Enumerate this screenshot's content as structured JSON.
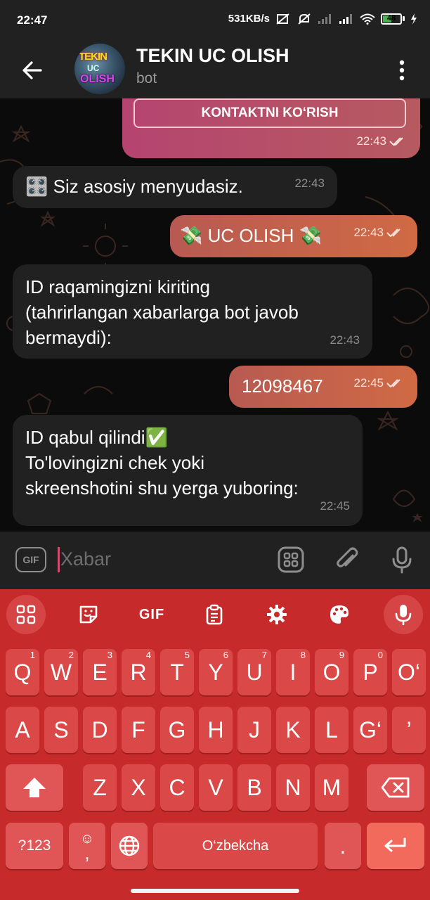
{
  "status_bar": {
    "time": "22:47",
    "network_speed": "531KB/s",
    "battery": "48",
    "battery_level": 0.48,
    "icons": [
      "screenshot-off-icon",
      "mute-icon",
      "signal-icon",
      "signal-icon",
      "wifi-icon",
      "battery-icon",
      "charging-icon"
    ]
  },
  "header": {
    "title": "TEKIN UC OLISH",
    "subtitle": "bot",
    "avatar_text": [
      "TEKIN",
      "UC",
      "OLISH"
    ]
  },
  "chat": {
    "top_message": {
      "button_label": "KONTAKTNI KO‘RISH",
      "time": "22:43"
    },
    "messages": [
      {
        "side": "in",
        "text": "🎛️ Siz asosiy menyudasiz.",
        "time": "22:43"
      },
      {
        "side": "out",
        "text": "💸 UC OLISH 💸",
        "time": "22:43"
      },
      {
        "side": "in",
        "lines": [
          "ID raqamingizni kiriting",
          "(tahrirlangan xabarlarga bot javob",
          "bermaydi):"
        ],
        "time": "22:43"
      },
      {
        "side": "out",
        "text": "12098467",
        "time": "22:45"
      },
      {
        "side": "in",
        "lines": [
          "ID qabul qilindi✅",
          "To'lovingizni chek yoki",
          "skreenshotini shu yerga yuboring:"
        ],
        "time": "22:45"
      }
    ]
  },
  "input_bar": {
    "gif_label": "GIF",
    "placeholder": "Xabar"
  },
  "keyboard": {
    "toolbar": {
      "gif_label": "GIF"
    },
    "row1": [
      {
        "k": "Q",
        "h": "1"
      },
      {
        "k": "W",
        "h": "2"
      },
      {
        "k": "E",
        "h": "3"
      },
      {
        "k": "R",
        "h": "4"
      },
      {
        "k": "T",
        "h": "5"
      },
      {
        "k": "Y",
        "h": "6"
      },
      {
        "k": "U",
        "h": "7"
      },
      {
        "k": "I",
        "h": "8"
      },
      {
        "k": "O",
        "h": "9"
      },
      {
        "k": "P",
        "h": "0"
      },
      {
        "k": "O‘",
        "h": ""
      }
    ],
    "row2": [
      "A",
      "S",
      "D",
      "F",
      "G",
      "H",
      "J",
      "K",
      "L",
      "G‘",
      "’"
    ],
    "row3": [
      "Z",
      "X",
      "C",
      "V",
      "B",
      "N",
      "M"
    ],
    "row4": {
      "symbols": "?123",
      "emoji_top": "☺",
      "emoji_bottom": ",",
      "space": "O‘zbekcha",
      "period": "."
    }
  },
  "colors": {
    "outgoing_bubble": "#c8604a",
    "incoming_bubble": "#212121",
    "keyboard": "#c62a2a",
    "key": "#da4848"
  }
}
